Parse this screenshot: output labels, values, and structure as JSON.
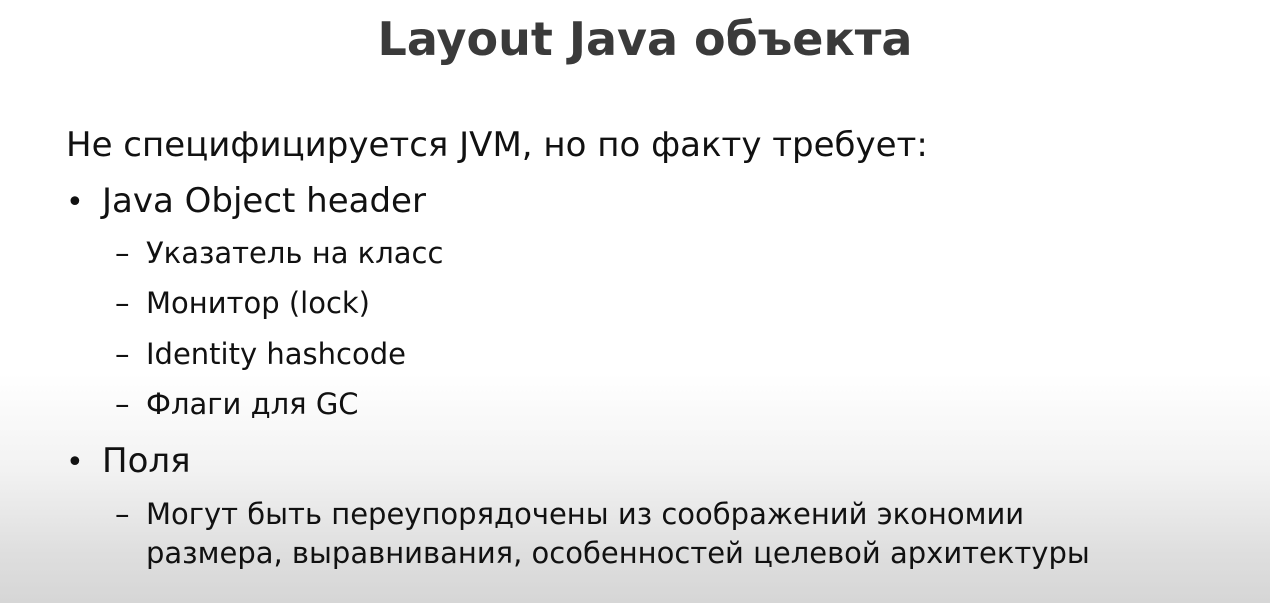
{
  "slide": {
    "title": "Layout Java объекта",
    "intro": "Не специфицируется JVM, но по факту требует:",
    "bullets": [
      {
        "marker": "•",
        "text": "Java Object header",
        "subitems": [
          {
            "marker": "–",
            "text": "Указатель на класс"
          },
          {
            "marker": "–",
            "text": "Монитор (lock)"
          },
          {
            "marker": "–",
            "text": "Identity hashcode"
          },
          {
            "marker": "–",
            "text": "Флаги для GC"
          }
        ]
      },
      {
        "marker": "•",
        "text": "Поля",
        "subitems": [
          {
            "marker": "–",
            "text": "Могут быть переупорядочены из соображений экономии",
            "continuation": "размера, выравнивания, особенностей целевой архитектуры"
          }
        ]
      }
    ]
  }
}
